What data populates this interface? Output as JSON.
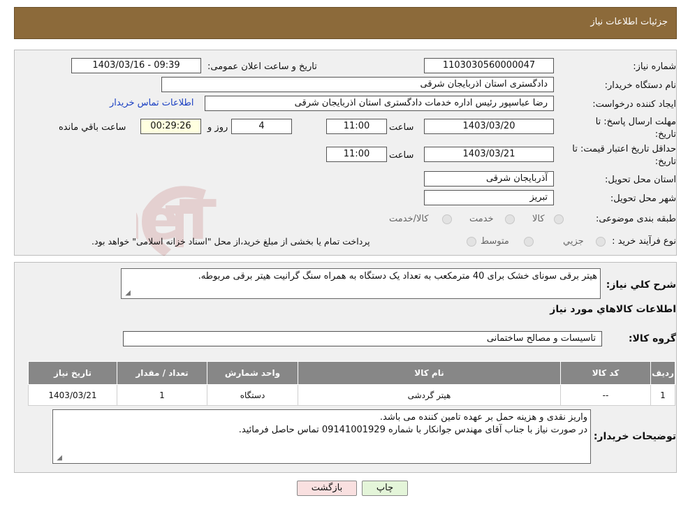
{
  "header": {
    "title": "جزئیات اطلاعات نیاز"
  },
  "form": {
    "need_number_label": "شماره نیاز:",
    "need_number": "1103030560000047",
    "announce_label": "تاریخ و ساعت اعلان عمومی:",
    "announce_value": "1403/03/16 - 09:39",
    "buyer_org_label": "نام دستگاه خریدار:",
    "buyer_org": "دادگستری استان اذربایجان شرقی",
    "creator_label": "ایجاد کننده درخواست:",
    "creator": "رضا عباسپور رئیس اداره خدمات دادگستری استان اذربایجان شرقی",
    "contact_link": "اطلاعات تماس خریدار",
    "deadline_label_1": "مهلت ارسال پاسخ: تا",
    "deadline_label_2": "تاریخ:",
    "deadline_date": "1403/03/20",
    "time_label": "ساعت",
    "deadline_time": "11:00",
    "days_value": "4",
    "days_label": "روز و",
    "remaining_time": "00:29:26",
    "remaining_label": "ساعت باقي مانده",
    "validity_label_1": "حداقل تاریخ اعتبار قیمت: تا",
    "validity_label_2": "تاریخ:",
    "validity_date": "1403/03/21",
    "validity_time": "11:00",
    "province_label": "استان محل تحویل:",
    "province": "آذربایجان شرقی",
    "city_label": "شهر محل تحویل:",
    "city": "تبریز",
    "category_label": "طبقه بندی موضوعی:",
    "category_options": [
      "کالا",
      "خدمت",
      "کالا/خدمت"
    ],
    "process_label": "نوع فرآیند خرید :",
    "process_options": [
      "جزیي",
      "متوسط"
    ],
    "process_note": "پرداخت تمام یا بخشی از مبلغ خرید،از محل \"اسناد خزانه اسلامی\" خواهد بود."
  },
  "description": {
    "label": "شرح كلي نياز:",
    "text": "هیتر برقی سونای خشک برای 40 مترمکعب به تعداد یک دستگاه به همراه سنگ گرانیت هیتر برقی مربوطه.",
    "goods_info_title": "اطلاعات کالاهاي مورد نياز",
    "group_label": "گروه کالا:",
    "group_value": "تاسیسات و مصالح ساختمانی"
  },
  "table": {
    "headers": [
      "ردیف",
      "کد کالا",
      "نام کالا",
      "واحد شمارش",
      "تعداد / مقدار",
      "تاریخ نیاز"
    ],
    "rows": [
      [
        "1",
        "--",
        "هیتر گردشی",
        "دستگاه",
        "1",
        "1403/03/21"
      ]
    ]
  },
  "buyer_notes": {
    "label": "توضیحات خریدار:",
    "line1": "واریز نقدی و هزینه حمل بر عهده تامین کننده می باشد.",
    "line2": "در صورت نیاز با جناب آقای مهندس جوانکار با شماره 09141001929 تماس حاصل فرمائید."
  },
  "buttons": {
    "print": "چاپ",
    "back": "بازگشت"
  },
  "watermark": {
    "text": "AriaTender.neT"
  },
  "colors": {
    "header": "#8c6a3a",
    "table_header": "#878787",
    "back_button": "#f9e0e0",
    "print_button": "#e4f5d9",
    "link": "#1a3fc2"
  }
}
